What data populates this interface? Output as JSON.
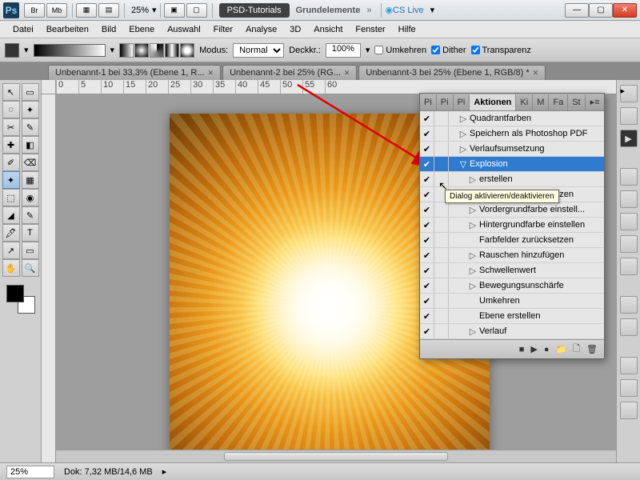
{
  "titlebar": {
    "app_short": "Ps",
    "btn_br": "Br",
    "btn_mb": "Mb",
    "zoom": "25%",
    "workspace_pill": "PSD-Tutorials",
    "workspace_label": "Grundelemente",
    "chevrons": "»",
    "cslive": "CS Live"
  },
  "menu": [
    "Datei",
    "Bearbeiten",
    "Bild",
    "Ebene",
    "Auswahl",
    "Filter",
    "Analyse",
    "3D",
    "Ansicht",
    "Fenster",
    "Hilfe"
  ],
  "options": {
    "modus_label": "Modus:",
    "modus_value": "Normal",
    "deckk_label": "Deckkr.:",
    "deckk_value": "100%",
    "umkehren_label": "Umkehren",
    "dither_label": "Dither",
    "transparenz_label": "Transparenz",
    "umkehren": false,
    "dither": true,
    "transparenz": true
  },
  "tabs": [
    {
      "label": "Unbenannt-1 bei 33,3% (Ebene 1, R..."
    },
    {
      "label": "Unbenannt-2 bei 25% (RG..."
    },
    {
      "label": "Unbenannt-3 bei 25% (Ebene 1, RGB/8) *"
    }
  ],
  "ruler_marks": [
    "0",
    "5",
    "10",
    "15",
    "20",
    "25",
    "30",
    "35",
    "40",
    "45",
    "50",
    "55",
    "60"
  ],
  "actions_panel": {
    "tabs_short": [
      "Pi",
      "Pi",
      "Pi"
    ],
    "tab_active": "Aktionen",
    "tabs_short2": [
      "Ki",
      "M",
      "Fa",
      "St"
    ],
    "rows": [
      {
        "chk": true,
        "dlg": false,
        "depth": 2,
        "tw": "▷",
        "label": "Quadrantfarben",
        "sel": false
      },
      {
        "chk": true,
        "dlg": false,
        "depth": 2,
        "tw": "▷",
        "label": "Speichern als Photoshop PDF",
        "sel": false
      },
      {
        "chk": true,
        "dlg": false,
        "depth": 2,
        "tw": "▷",
        "label": "Verlaufsumsetzung",
        "sel": false
      },
      {
        "chk": true,
        "dlg": false,
        "depth": 2,
        "tw": "▽",
        "label": "Explosion",
        "sel": true
      },
      {
        "chk": true,
        "dlg": false,
        "depth": 3,
        "tw": "▷",
        "label": "erstellen",
        "sel": false
      },
      {
        "chk": true,
        "dlg": false,
        "depth": 3,
        "tw": "▷",
        "label": "Farbfelder zurücksetzen",
        "sel": false
      },
      {
        "chk": true,
        "dlg": false,
        "depth": 3,
        "tw": "▷",
        "label": "Vordergrundfarbe einstell...",
        "sel": false
      },
      {
        "chk": true,
        "dlg": false,
        "depth": 3,
        "tw": "▷",
        "label": "Hintergrundfarbe einstellen",
        "sel": false
      },
      {
        "chk": true,
        "dlg": false,
        "depth": 3,
        "tw": "",
        "label": "Farbfelder zurücksetzen",
        "sel": false
      },
      {
        "chk": true,
        "dlg": false,
        "depth": 3,
        "tw": "▷",
        "label": "Rauschen hinzufügen",
        "sel": false
      },
      {
        "chk": true,
        "dlg": false,
        "depth": 3,
        "tw": "▷",
        "label": "Schwellenwert",
        "sel": false
      },
      {
        "chk": true,
        "dlg": false,
        "depth": 3,
        "tw": "▷",
        "label": "Bewegungsunschärfe",
        "sel": false
      },
      {
        "chk": true,
        "dlg": false,
        "depth": 3,
        "tw": "",
        "label": "Umkehren",
        "sel": false
      },
      {
        "chk": true,
        "dlg": false,
        "depth": 3,
        "tw": "",
        "label": "Ebene erstellen",
        "sel": false
      },
      {
        "chk": true,
        "dlg": false,
        "depth": 3,
        "tw": "▷",
        "label": "Verlauf",
        "sel": false
      }
    ],
    "foot_icons": [
      "■",
      "▶",
      "●",
      "📁",
      "🗋",
      "🗑"
    ]
  },
  "tooltip": "Dialog aktivieren/deaktivieren",
  "status": {
    "zoom": "25%",
    "doc": "Dok: 7,32 MB/14,6 MB"
  },
  "tool_glyphs": [
    [
      "↖",
      "▭"
    ],
    [
      "◌",
      "✦"
    ],
    [
      "✂",
      "✎"
    ],
    [
      "✚",
      "◧"
    ],
    [
      "✐",
      "⌫"
    ],
    [
      "✦",
      "▦"
    ],
    [
      "⬚",
      "◉"
    ],
    [
      "◢",
      "✎"
    ],
    [
      "🖊",
      "T"
    ],
    [
      "↗",
      "▭"
    ],
    [
      "✋",
      "🔍"
    ]
  ]
}
